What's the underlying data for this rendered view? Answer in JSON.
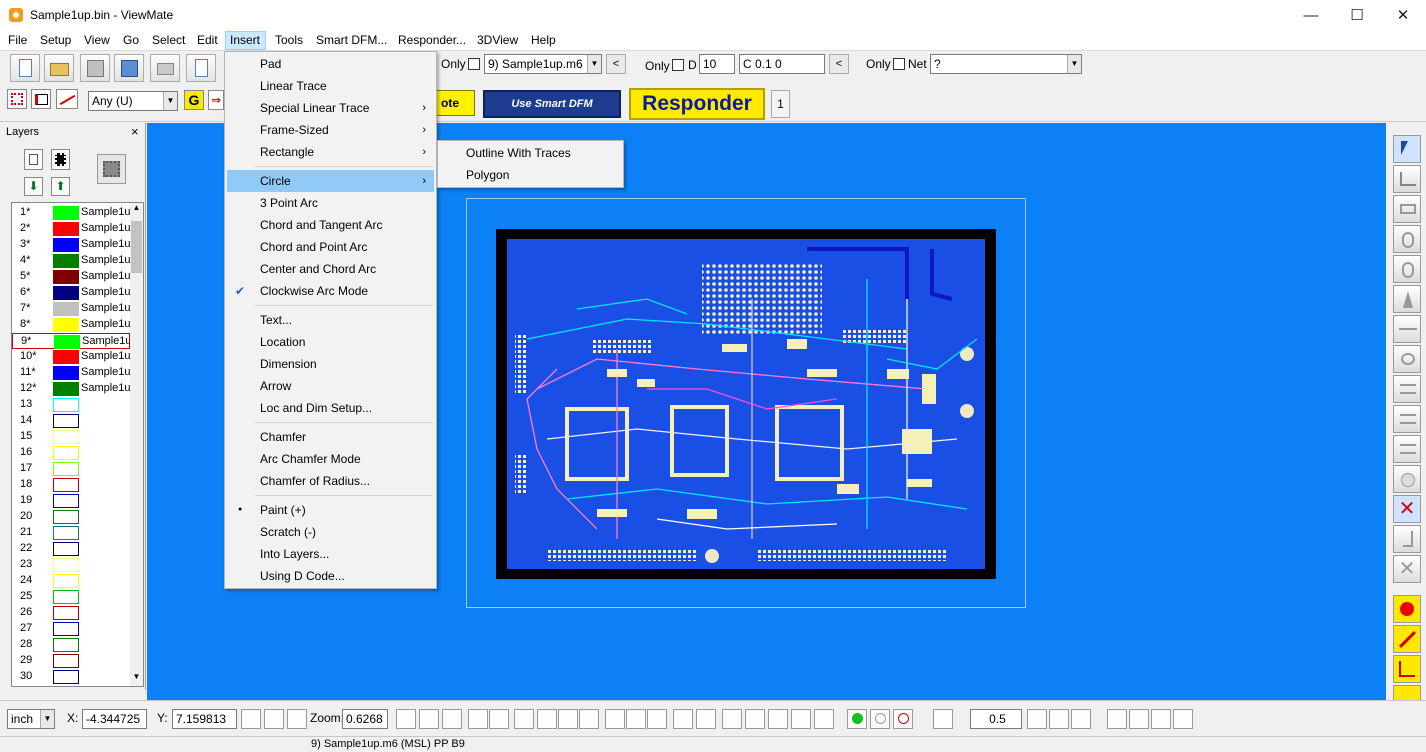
{
  "window": {
    "title": "Sample1up.bin - ViewMate",
    "minimize": "—",
    "maximize": "☐",
    "close": "✕"
  },
  "menubar": [
    "File",
    "Setup",
    "View",
    "Go",
    "Select",
    "Edit",
    "Insert",
    "Tools",
    "Smart DFM...",
    "Responder...",
    "3DView",
    "Help"
  ],
  "toolbar1": {
    "only1_label": "Only",
    "layer_select": "9) Sample1up.m6",
    "prev_btn": "<",
    "only2_label": "Only",
    "d_label": "D",
    "d_value": "10",
    "dcode_text": "C 0.1  0",
    "prev2_btn": "<",
    "only3_label": "Only",
    "net_label": "Net",
    "net_value": "?"
  },
  "toolbar2": {
    "any_select": "Any    (U)",
    "quote_btn": "ote",
    "smart_dfm_btn": "Use Smart DFM",
    "responder_btn": "Responder",
    "count": "1"
  },
  "layers": {
    "title": "Layers",
    "close": "×",
    "items": [
      {
        "num": "1*",
        "color": "#00ff00",
        "name": "Sample1u"
      },
      {
        "num": "2*",
        "color": "#ff0000",
        "name": "Sample1u"
      },
      {
        "num": "3*",
        "color": "#0000ff",
        "name": "Sample1u"
      },
      {
        "num": "4*",
        "color": "#008000",
        "name": "Sample1u"
      },
      {
        "num": "5*",
        "color": "#800000",
        "name": "Sample1u"
      },
      {
        "num": "6*",
        "color": "#000080",
        "name": "Sample1u"
      },
      {
        "num": "7*",
        "color": "#c0c0c0",
        "name": "Sample1u"
      },
      {
        "num": "8*",
        "color": "#ffff00",
        "name": "Sample1u"
      },
      {
        "num": "9*",
        "color": "#00ff00",
        "name": "Sample1u",
        "selected": true
      },
      {
        "num": "10*",
        "color": "#ff0000",
        "name": "Sample1u"
      },
      {
        "num": "11*",
        "color": "#0000ff",
        "name": "Sample1u"
      },
      {
        "num": "12*",
        "color": "#008000",
        "name": "Sample1u"
      },
      {
        "num": "13",
        "outline": "#00ffff",
        "name": ""
      },
      {
        "num": "14",
        "outline": "#000080",
        "name": ""
      },
      {
        "num": "15",
        "outline": "#ffff80",
        "name": ""
      },
      {
        "num": "16",
        "outline": "#ffff00",
        "name": ""
      },
      {
        "num": "17",
        "outline": "#80ff00",
        "name": ""
      },
      {
        "num": "18",
        "outline": "#c00000",
        "name": ""
      },
      {
        "num": "19",
        "outline": "#0000c0",
        "name": ""
      },
      {
        "num": "20",
        "outline": "#008000",
        "name": ""
      },
      {
        "num": "21",
        "outline": "#008080",
        "name": ""
      },
      {
        "num": "22",
        "outline": "#000080",
        "name": ""
      },
      {
        "num": "23",
        "outline": "#ffff80",
        "name": ""
      },
      {
        "num": "24",
        "outline": "#ffff00",
        "name": ""
      },
      {
        "num": "25",
        "outline": "#00c000",
        "name": ""
      },
      {
        "num": "26",
        "outline": "#c00000",
        "name": ""
      },
      {
        "num": "27",
        "outline": "#0000c0",
        "name": ""
      },
      {
        "num": "28",
        "outline": "#008000",
        "name": ""
      },
      {
        "num": "29",
        "outline": "#800000",
        "name": ""
      },
      {
        "num": "30",
        "outline": "#000080",
        "name": ""
      }
    ]
  },
  "insert_menu": [
    {
      "label": "Pad"
    },
    {
      "label": "Linear Trace"
    },
    {
      "label": "Special Linear Trace",
      "submenu": true
    },
    {
      "label": "Frame-Sized",
      "submenu": true
    },
    {
      "label": "Rectangle",
      "submenu": true
    },
    {
      "sep": true
    },
    {
      "label": "Circle",
      "submenu": true,
      "highlight": true
    },
    {
      "label": "3 Point Arc"
    },
    {
      "label": "Chord and Tangent Arc"
    },
    {
      "label": "Chord and Point Arc"
    },
    {
      "label": "Center and Chord Arc"
    },
    {
      "label": "Clockwise Arc Mode",
      "check": true
    },
    {
      "sep": true
    },
    {
      "label": "Text..."
    },
    {
      "label": "Location"
    },
    {
      "label": "Dimension"
    },
    {
      "label": "Arrow"
    },
    {
      "label": "Loc and Dim Setup..."
    },
    {
      "sep": true
    },
    {
      "label": "Chamfer"
    },
    {
      "label": "Arc Chamfer Mode"
    },
    {
      "label": "Chamfer of Radius..."
    },
    {
      "sep": true
    },
    {
      "label": "Paint (+)",
      "bullet": true
    },
    {
      "label": "Scratch (-)"
    },
    {
      "label": "Into Layers..."
    },
    {
      "label": "Using D Code..."
    }
  ],
  "circle_submenu": [
    "Outline With Traces",
    "Polygon"
  ],
  "bottombar": {
    "units": "inch",
    "x_label": "X:",
    "x_value": "-4.344725",
    "y_label": "Y:",
    "y_value": "7.159813",
    "zoom_label": "Zoom:",
    "zoom_value": "0.6268",
    "grid_value": "0.5"
  },
  "status": "9) Sample1up.m6 (MSL) PP B9",
  "colors": {
    "canvas": "#0c81f7",
    "board": "#1a4fe6",
    "menu_highlight": "#91c9f7"
  }
}
